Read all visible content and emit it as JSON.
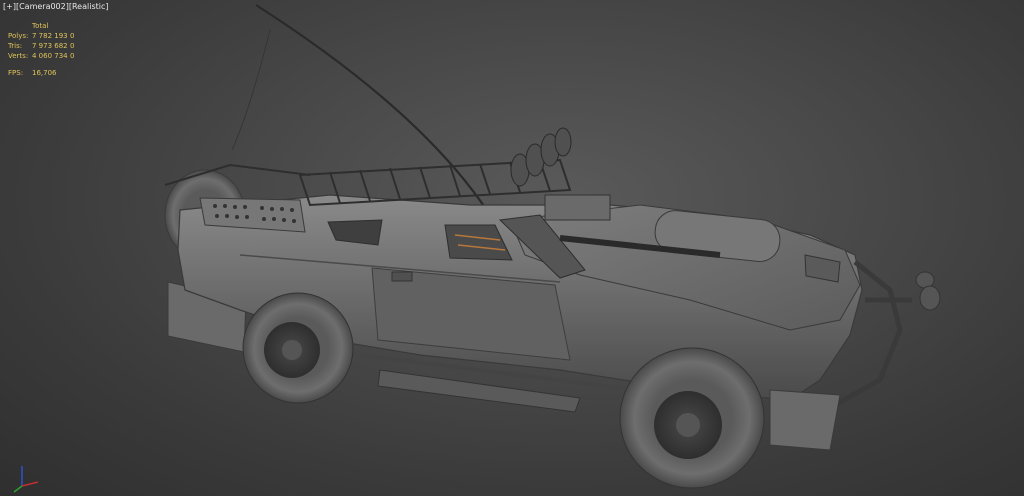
{
  "viewport": {
    "label_plus": "[+]",
    "label_camera": "[Camera002]",
    "label_shading": "[Realistic]"
  },
  "stats": {
    "header": "Total",
    "rows": [
      {
        "label": "Polys:",
        "value": "7 782 193",
        "sel": "0"
      },
      {
        "label": "Tris:",
        "value": "7 973 682",
        "sel": "0"
      },
      {
        "label": "Verts:",
        "value": "4 060 734",
        "sel": "0"
      }
    ],
    "fps_label": "FPS:",
    "fps_value": "16,706"
  },
  "colors": {
    "stats_text": "#e0c45a",
    "label_text": "#e8e8e8",
    "model_gray": "#6e6e6e"
  },
  "axis": {
    "x_color": "#c03030",
    "y_color": "#30a030",
    "z_color": "#3050d0"
  }
}
